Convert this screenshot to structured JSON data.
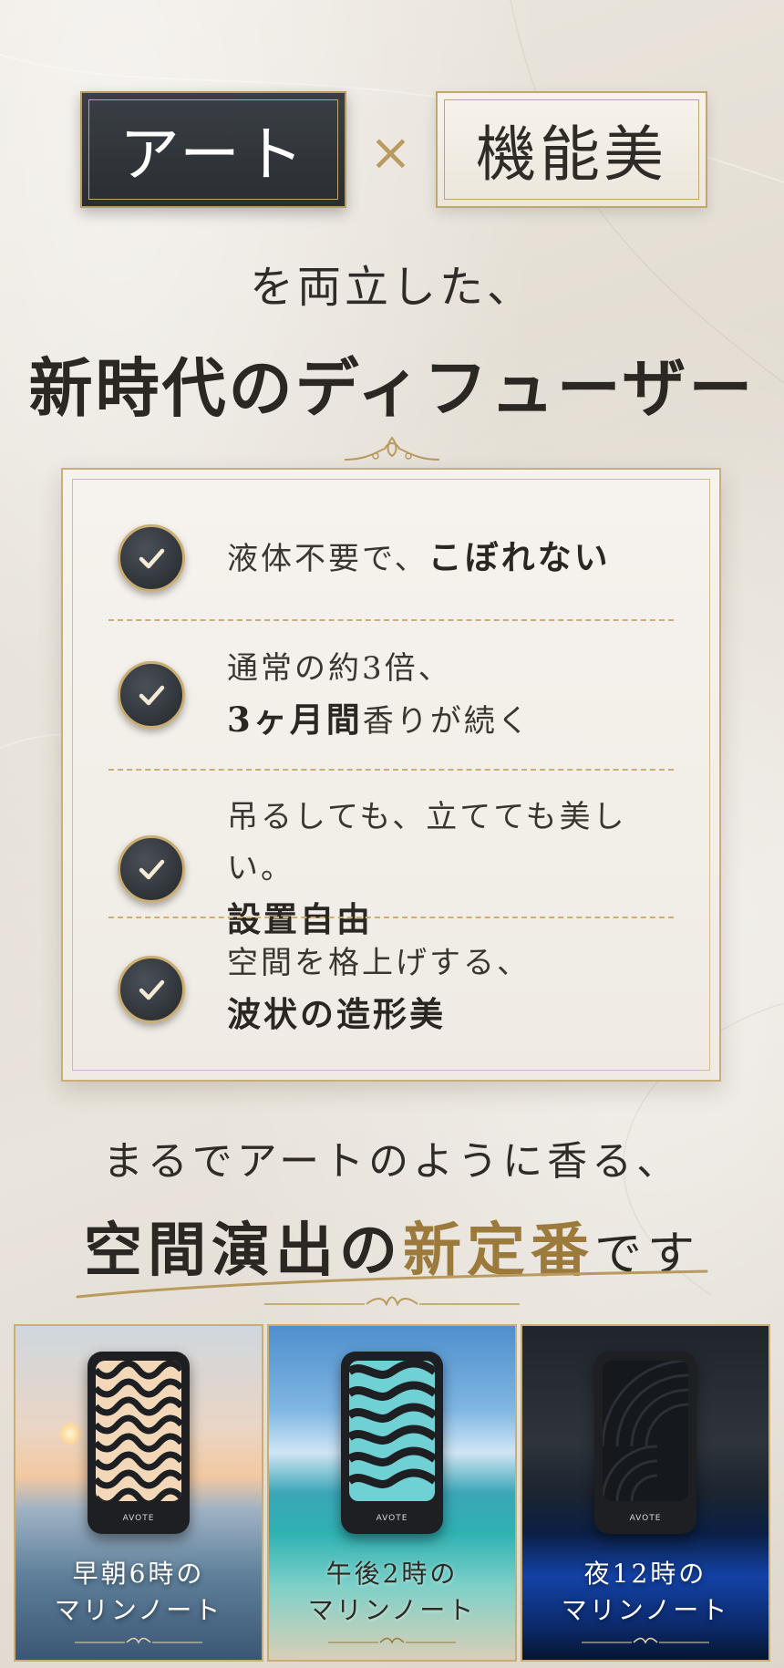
{
  "badges": {
    "left": "アート",
    "times": "×",
    "right": "機能美"
  },
  "heading": {
    "line1": "を両立した、",
    "line2": "新時代のディフューザー"
  },
  "features": [
    {
      "line1": "液体不要で、",
      "line1_bold": "こぼれない",
      "line2_bold": "",
      "line2": ""
    },
    {
      "line1": "通常の約3倍、",
      "line1_bold": "",
      "line2_bold": "3ヶ月間",
      "line2": "香りが続く"
    },
    {
      "line1": "吊るしても、立てても美しい。",
      "line1_bold": "",
      "line2_bold": "設置自由",
      "line2": ""
    },
    {
      "line1": "空間を格上げする、",
      "line1_bold": "",
      "line2_bold": "波状の造形美",
      "line2": ""
    }
  ],
  "tagline": {
    "line1": "まるでアートのように香る、",
    "part1": "空間演出の",
    "part2": "新定番",
    "part3": "です"
  },
  "panels": [
    {
      "line1": "早朝6時の",
      "line2": "マリンノート",
      "brand": "AVOTE"
    },
    {
      "line1": "午後2時の",
      "line2": "マリンノート",
      "brand": "AVOTE"
    },
    {
      "line1": "夜12時の",
      "line2": "マリンノート",
      "brand": "AVOTE"
    }
  ],
  "colors": {
    "gold": "#c2a76d",
    "dark": "#2e3237",
    "accent_text": "#9c7a3c"
  }
}
